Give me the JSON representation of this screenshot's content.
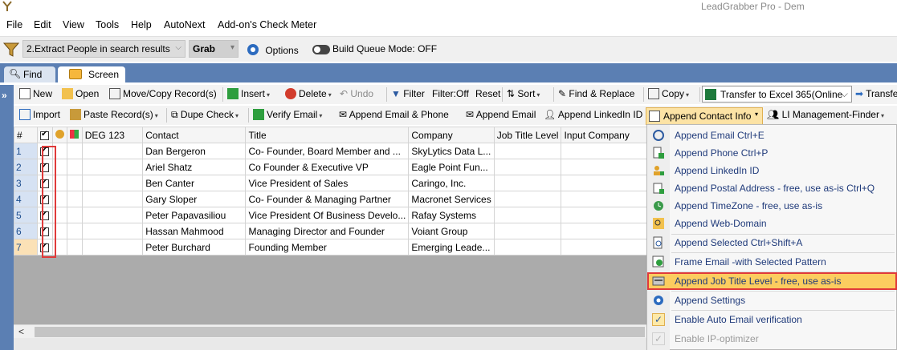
{
  "window": {
    "title": "LeadGrabber Pro - Dem"
  },
  "menubar": {
    "items": [
      "File",
      "Edit",
      "View",
      "Tools",
      "Help",
      "AutoNext",
      "Add-on's Check Meter"
    ]
  },
  "toolbar1": {
    "mode_select": "2.Extract People in search results",
    "grab_label": "Grab",
    "options_label": "Options",
    "build_queue_label": "Build Queue Mode: OFF"
  },
  "tabs": {
    "find": "Find",
    "screen": "Screen"
  },
  "toolbar2": {
    "new": "New",
    "open": "Open",
    "move_copy": "Move/Copy Record(s)",
    "insert": "Insert",
    "delete": "Delete",
    "undo": "Undo",
    "filter": "Filter",
    "filter_off": "Filter:Off",
    "reset": "Reset",
    "sort": "Sort",
    "find_replace": "Find & Replace",
    "copy": "Copy",
    "transfer_select": "Transfer to Excel 365(Online",
    "transfer_btn": "Transfe"
  },
  "toolbar3": {
    "import": "Import",
    "paste": "Paste Record(s)",
    "dupe_check": "Dupe Check",
    "verify_email": "Verify Email",
    "append_email_phone": "Append Email & Phone",
    "append_email": "Append Email",
    "append_linkedin": "Append LinkedIn ID",
    "append_contact_info": "Append Contact Info",
    "li_management": "LI Management-Finder"
  },
  "grid": {
    "columns": [
      "#",
      "",
      "",
      "",
      "DEG 123",
      "Contact",
      "Title",
      "Company",
      "Job Title Level",
      "Input Company"
    ],
    "rows": [
      {
        "num": "1",
        "contact": "Dan Bergeron",
        "title": "Co- Founder, Board Member and ...",
        "company": "SkyLytics Data L..."
      },
      {
        "num": "2",
        "contact": "Ariel Shatz",
        "title": "Co Founder & Executive VP",
        "company": "Eagle Point Fun..."
      },
      {
        "num": "3",
        "contact": "Ben Canter",
        "title": "Vice President of Sales",
        "company": "Caringo, Inc."
      },
      {
        "num": "4",
        "contact": "Gary Sloper",
        "title": "Co- Founder & Managing Partner",
        "company": "Macronet Services"
      },
      {
        "num": "5",
        "contact": "Peter Papavasiliou",
        "title": "Vice President Of Business Develo...",
        "company": "Rafay Systems"
      },
      {
        "num": "6",
        "contact": "Hassan Mahmood",
        "title": "Managing Director and Founder",
        "company": "Voiant Group"
      },
      {
        "num": "7",
        "contact": "Peter Burchard",
        "title": "Founding Member",
        "company": "Emerging Leade..."
      }
    ],
    "scroll_left": "<"
  },
  "contact_menu": {
    "items": [
      {
        "label": "Append Email   Ctrl+E",
        "icon": "email-search-icon"
      },
      {
        "label": "Append Phone   Ctrl+P",
        "icon": "phone-plus-icon"
      },
      {
        "label": "Append LinkedIn ID",
        "icon": "person-plus-icon"
      },
      {
        "label": "Append Postal Address - free, use as-is Ctrl+Q",
        "icon": "address-plus-icon"
      },
      {
        "label": "Append TimeZone - free, use as-is",
        "icon": "timezone-icon"
      },
      {
        "label": "Append Web-Domain",
        "icon": "web-search-icon"
      },
      {
        "label": "Append Selected   Ctrl+Shift+A",
        "icon": "document-search-icon"
      },
      {
        "label": "Frame Email -with Selected Pattern",
        "icon": "frame-email-icon"
      },
      {
        "label": "Append Job Title Level - free, use as-is",
        "icon": "job-title-icon"
      },
      {
        "label": "Append Settings",
        "icon": "gear-icon"
      },
      {
        "label": "Enable Auto Email verification",
        "icon": "check-icon"
      },
      {
        "label": "Enable IP-optimizer",
        "icon": "check-disabled-icon"
      }
    ]
  },
  "colors": {
    "accent": "#5b7fb3",
    "highlight": "#fccd5f",
    "annotation_red": "#e03a3a"
  }
}
